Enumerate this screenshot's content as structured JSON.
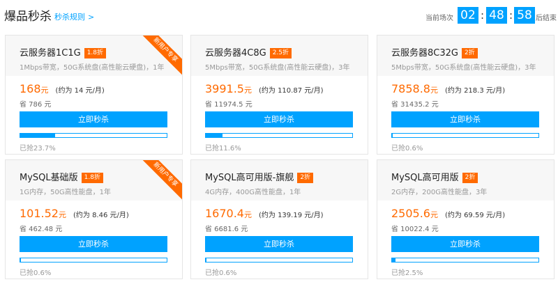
{
  "header": {
    "title": "爆品秒杀",
    "rules_link": "秒杀规则",
    "timer_label": "当前场次",
    "hours": "02",
    "minutes": "48",
    "seconds": "58",
    "separator": ":",
    "timer_end_label": "后结束"
  },
  "buy_label": "立即秒杀",
  "ribbon_text": "新用户专享",
  "price_unit": "元",
  "colors": {
    "accent": "#00a2ff",
    "discount": "#ff6a00"
  },
  "products": [
    {
      "name": "云服务器1C1G",
      "discount": "1.8折",
      "spec": "1Mbps带宽，50G系统盘(高性能云硬盘)，1年",
      "price": "168",
      "approx": "(约为 14 元/月)",
      "save": "省 786 元",
      "sold": "已抢23.7%",
      "sold_fraction": 0.237,
      "new_user": true
    },
    {
      "name": "云服务器4C8G",
      "discount": "2.5折",
      "spec": "5Mbps带宽，50G系统盘(高性能云硬盘)，3年",
      "price": "3991.5",
      "approx": "(约为 110.87 元/月)",
      "save": "省 11974.5 元",
      "sold": "已抢11.6%",
      "sold_fraction": 0.116,
      "new_user": false
    },
    {
      "name": "云服务器8C32G",
      "discount": "2折",
      "spec": "5Mbps带宽，50G系统盘(高性能云硬盘)，3年",
      "price": "7858.8",
      "approx": "(约为 218.3 元/月)",
      "save": "省 31435.2 元",
      "sold": "已抢0.6%",
      "sold_fraction": 0.006,
      "new_user": false
    },
    {
      "name": "MySQL基础版",
      "discount": "1.8折",
      "spec": "1G内存，50G高性能盘，1年",
      "price": "101.52",
      "approx": "(约为 8.46 元/月)",
      "save": "省 462.48 元",
      "sold": "已抢0.6%",
      "sold_fraction": 0.006,
      "new_user": true
    },
    {
      "name": "MySQL高可用版-旗舰",
      "discount": "2折",
      "spec": "4G内存，400G高性能盘，1年",
      "price": "1670.4",
      "approx": "(约为 139.19 元/月)",
      "save": "省 6681.6 元",
      "sold": "已抢0.6%",
      "sold_fraction": 0.006,
      "new_user": false
    },
    {
      "name": "MySQL高可用版",
      "discount": "2折",
      "spec": "2G内存，200G高性能盘，3年",
      "price": "2505.6",
      "approx": "(约为 69.59 元/月)",
      "save": "省 10022.4 元",
      "sold": "已抢2.5%",
      "sold_fraction": 0.025,
      "new_user": false
    }
  ]
}
